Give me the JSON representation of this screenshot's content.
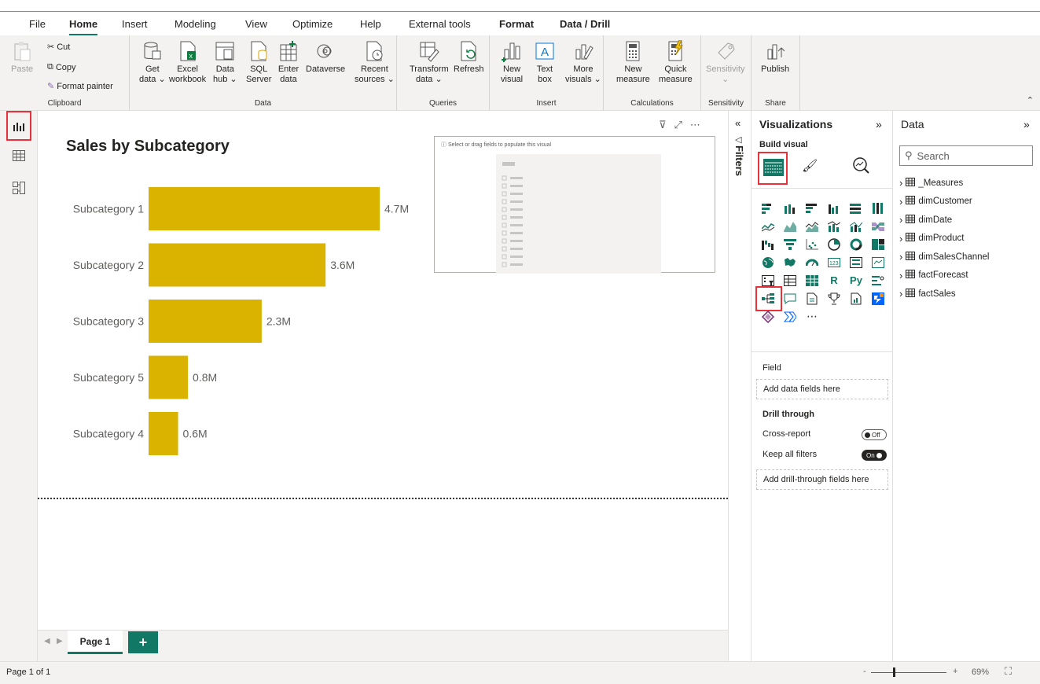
{
  "menu": {
    "tabs": [
      "File",
      "Home",
      "Insert",
      "Modeling",
      "View",
      "Optimize",
      "Help",
      "External tools",
      "Format",
      "Data / Drill"
    ],
    "active": "Home"
  },
  "ribbon": {
    "clipboard": {
      "paste": "Paste",
      "cut": "Cut",
      "copy": "Copy",
      "format_painter": "Format painter",
      "label": "Clipboard"
    },
    "data": {
      "get_data": [
        "Get",
        "data ⌄"
      ],
      "excel": [
        "Excel",
        "workbook"
      ],
      "data_hub": [
        "Data",
        "hub ⌄"
      ],
      "sql": [
        "SQL",
        "Server"
      ],
      "enter_data": [
        "Enter",
        "data"
      ],
      "dataverse": "Dataverse",
      "recent": [
        "Recent",
        "sources ⌄"
      ],
      "label": "Data"
    },
    "queries": {
      "transform": [
        "Transform",
        "data ⌄"
      ],
      "refresh": "Refresh",
      "label": "Queries"
    },
    "insert": {
      "new_visual": [
        "New",
        "visual"
      ],
      "text_box": [
        "Text",
        "box"
      ],
      "more_visuals": [
        "More",
        "visuals ⌄"
      ],
      "label": "Insert"
    },
    "calculations": {
      "new_measure": [
        "New",
        "measure"
      ],
      "quick_measure": [
        "Quick",
        "measure"
      ],
      "label": "Calculations"
    },
    "sensitivity": {
      "btn": "Sensitivity",
      "label": "Sensitivity"
    },
    "share": {
      "publish": "Publish",
      "label": "Share"
    }
  },
  "canvas": {
    "title": "Sales by Subcategory",
    "empty_visual_msg": "Select or drag fields to populate this visual"
  },
  "chart_data": {
    "type": "bar",
    "title": "Sales by Subcategory",
    "categories": [
      "Subcategory 1",
      "Subcategory 2",
      "Subcategory 3",
      "Subcategory 5",
      "Subcategory 4"
    ],
    "values": [
      4.7,
      3.6,
      2.3,
      0.8,
      0.6
    ],
    "data_labels": [
      "4.7M",
      "3.6M",
      "2.3M",
      "0.8M",
      "0.6M"
    ],
    "color": "#d9b300"
  },
  "pages": {
    "tab": "Page 1",
    "add": "+"
  },
  "status": {
    "page": "Page 1 of 1",
    "zoom": "69%"
  },
  "filters": {
    "label": "Filters"
  },
  "viz": {
    "title": "Visualizations",
    "build_visual": "Build visual",
    "field_label": "Field",
    "field_drop": "Add data fields here",
    "drill_through": "Drill through",
    "cross_report": "Cross-report",
    "cross_state": "Off",
    "keep_filters": "Keep all filters",
    "keep_state": "On",
    "drill_drop": "Add drill-through fields here"
  },
  "data_pane": {
    "title": "Data",
    "search_placeholder": "Search",
    "tables": [
      "_Measures",
      "dimCustomer",
      "dimDate",
      "dimProduct",
      "dimSalesChannel",
      "factForecast",
      "factSales"
    ]
  }
}
